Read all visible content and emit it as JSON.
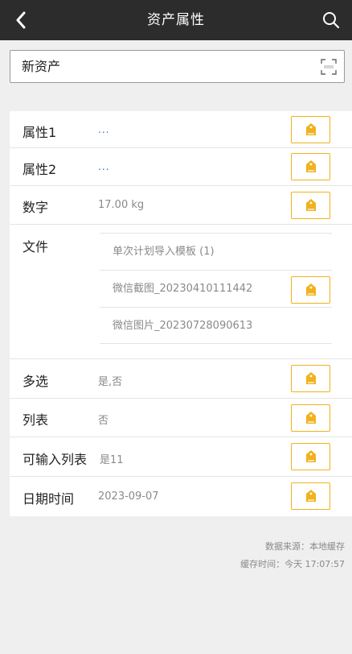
{
  "header": {
    "title": "资产属性"
  },
  "asset": {
    "name": "新资产"
  },
  "rows": [
    {
      "label": "属性1",
      "value": "..."
    },
    {
      "label": "属性2",
      "value": "..."
    },
    {
      "label": "数字",
      "value": "17.00 kg"
    },
    {
      "label": "文件",
      "files": [
        "单次计划导入模板 (1)",
        "微信截图_20230410111442",
        "微信图片_20230728090613"
      ]
    },
    {
      "label": "多选",
      "value": "是,否"
    },
    {
      "label": "列表",
      "value": "否"
    },
    {
      "label": "可输入列表",
      "value": "是11"
    },
    {
      "label": "日期时间",
      "value": "2023-09-07"
    }
  ],
  "footer": {
    "source": "数据来源：本地缓存",
    "cache_time": "缓存时间：今天 17:07:57"
  },
  "colors": {
    "topbar": "#2c2c2c",
    "accent": "#f0b21e",
    "background": "#efefef"
  }
}
